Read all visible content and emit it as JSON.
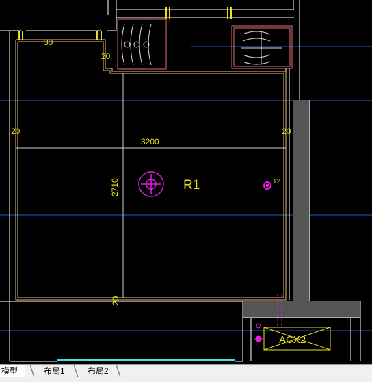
{
  "drawing": {
    "room_label": "R1",
    "unit_label": "ACX2",
    "dim_width": "3200",
    "dim_height": "2710",
    "dim_30": "30",
    "dim_20_top": "20",
    "dim_20_left": "20",
    "dim_20_right": "20",
    "dim_20_bottom": "20",
    "dim_12": "12",
    "colors": {
      "background": "#000000",
      "wall_line": "#ffffff",
      "room_outline": "#f0c080",
      "dimension": "#e8e020",
      "grid": "#1e5ad8",
      "marker": "#e020e0",
      "fixture_outline": "#e07070",
      "wall_fill": "#555555"
    }
  },
  "layout_tabs": {
    "tabs": [
      {
        "label": "模型",
        "active": true
      },
      {
        "label": "布局1",
        "active": false
      },
      {
        "label": "布局2",
        "active": false
      }
    ]
  }
}
